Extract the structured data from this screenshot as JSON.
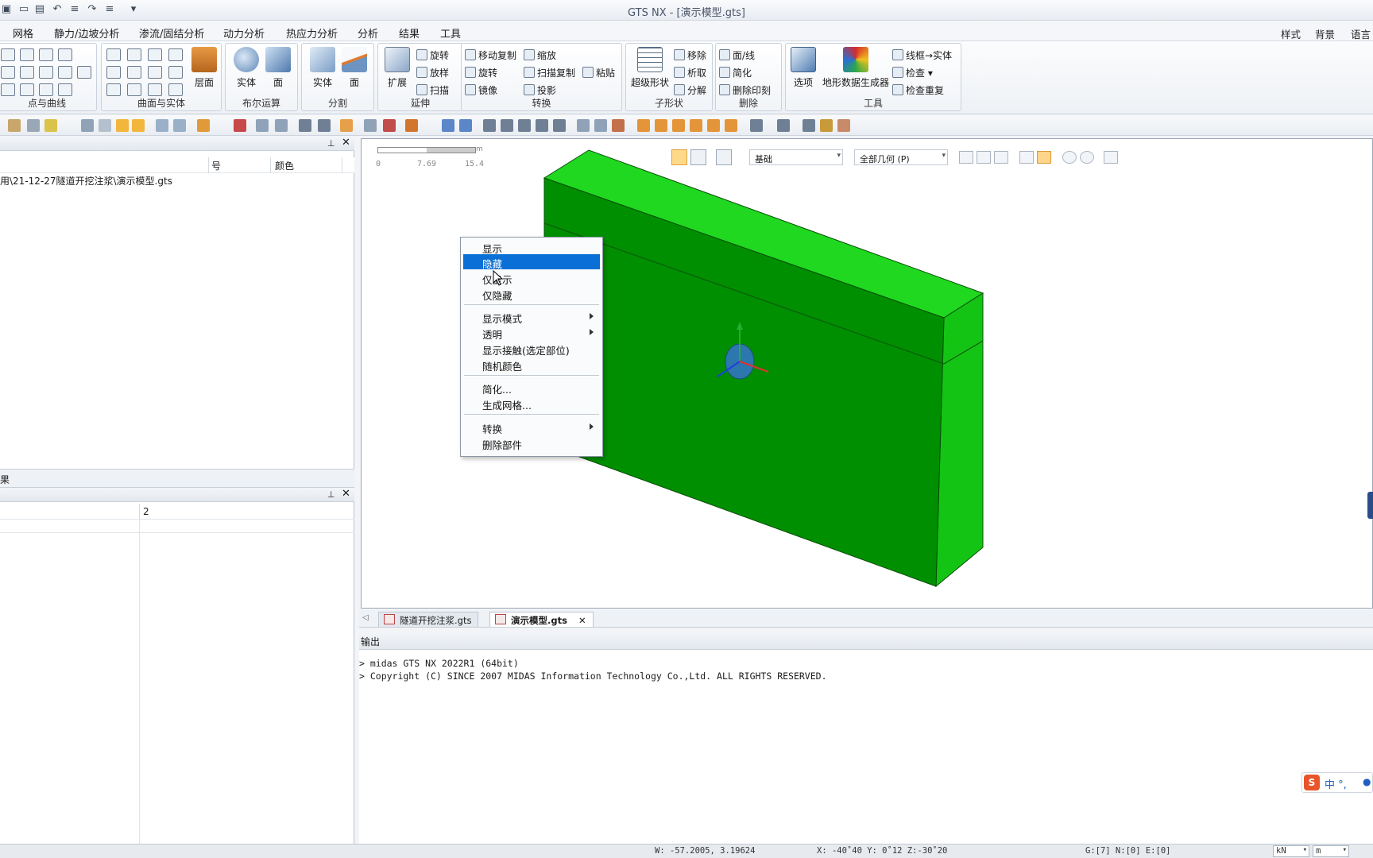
{
  "app": {
    "title": "GTS NX - [演示模型.gts]"
  },
  "menu": {
    "items": [
      "网格",
      "静力/边坡分析",
      "渗流/固结分析",
      "动力分析",
      "热应力分析",
      "分析",
      "结果",
      "工具"
    ],
    "right": [
      "样式",
      "背景",
      "语言"
    ]
  },
  "ribbon": {
    "groups": [
      {
        "label": "点与曲线"
      },
      {
        "label": "曲面与实体",
        "big": "层面"
      },
      {
        "label": "布尔运算",
        "big": [
          "实体",
          "面"
        ]
      },
      {
        "label": "分割",
        "big": [
          "实体",
          "面"
        ]
      },
      {
        "label": "延伸",
        "big": "扩展",
        "small": [
          "旋转",
          "放样",
          "扫描"
        ]
      },
      {
        "label": "转换",
        "small": [
          "移动复制",
          "缩放",
          "旋转",
          "扫描复制",
          "粘贴",
          "镜像",
          "投影"
        ]
      },
      {
        "label": "子形状",
        "big": "超级形状",
        "small": [
          "移除",
          "析取",
          "分解"
        ]
      },
      {
        "label": "删除",
        "small": [
          "面/线",
          "简化",
          "删除印刻"
        ]
      },
      {
        "label": "工具",
        "big": [
          "选项",
          "地形数据生成器"
        ],
        "small": [
          "线框→实体",
          "检查",
          "检查重复"
        ]
      }
    ]
  },
  "tree_panel": {
    "col_number": "号",
    "col_color": "颜色",
    "path": "用\\21-12-27隧道开挖注浆\\演示模型.gts"
  },
  "left_mid_label": "果",
  "props_panel": {
    "col2": "2"
  },
  "viewport": {
    "scale": {
      "unit": "m",
      "ticks": [
        "0",
        "7.69",
        "15.4"
      ]
    },
    "combo1": "基础",
    "combo2": "全部几何 (P)"
  },
  "context_menu": {
    "items": [
      {
        "label": "显示"
      },
      {
        "label": "隐藏",
        "selected": true
      },
      {
        "label": "仅显示"
      },
      {
        "label": "仅隐藏"
      },
      {
        "label": "显示模式",
        "submenu": true
      },
      {
        "label": "透明",
        "submenu": true
      },
      {
        "label": "显示接触(选定部位)"
      },
      {
        "label": "随机颜色"
      },
      {
        "label": "简化..."
      },
      {
        "label": "生成网格..."
      },
      {
        "label": "转换",
        "submenu": true
      },
      {
        "label": "删除部件"
      }
    ]
  },
  "doc_tabs": [
    "隧道开挖注浆.gts",
    "演示模型.gts"
  ],
  "output": {
    "title": "输出",
    "lines": [
      "> midas GTS NX 2022R1 (64bit)",
      "> Copyright (C) SINCE 2007 MIDAS Information Technology Co.,Ltd. ALL RIGHTS RESERVED."
    ]
  },
  "status": {
    "w": "W: -57.2005, 3.19624",
    "xyz": "X: -40˚40 Y: 0˚12 Z:-30˚20",
    "g": "G:[7] N:[0] E:[0]",
    "unit1": "kN",
    "unit2": "m"
  },
  "ime": {
    "label": "中 °,"
  },
  "colors": {
    "model_front": "#008f00",
    "model_top": "#1fd81f",
    "model_side": "#12c812",
    "selection": "#0a6fd6"
  }
}
